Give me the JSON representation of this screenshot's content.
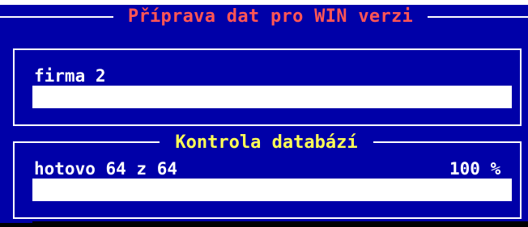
{
  "dialog": {
    "title": "Příprava dat pro WIN verzi"
  },
  "company_section": {
    "label": "firma 2",
    "progress_fraction": 1.0
  },
  "database_check": {
    "title": "Kontrola databází",
    "status_text": "hotovo 64 z 64",
    "percent_text": "100 %",
    "progress_fraction": 1.0
  },
  "colors": {
    "background": "#0000a8",
    "frame": "#ffffff",
    "dialog_title": "#ff5555",
    "group_title": "#ffff55",
    "text": "#ffffff"
  }
}
